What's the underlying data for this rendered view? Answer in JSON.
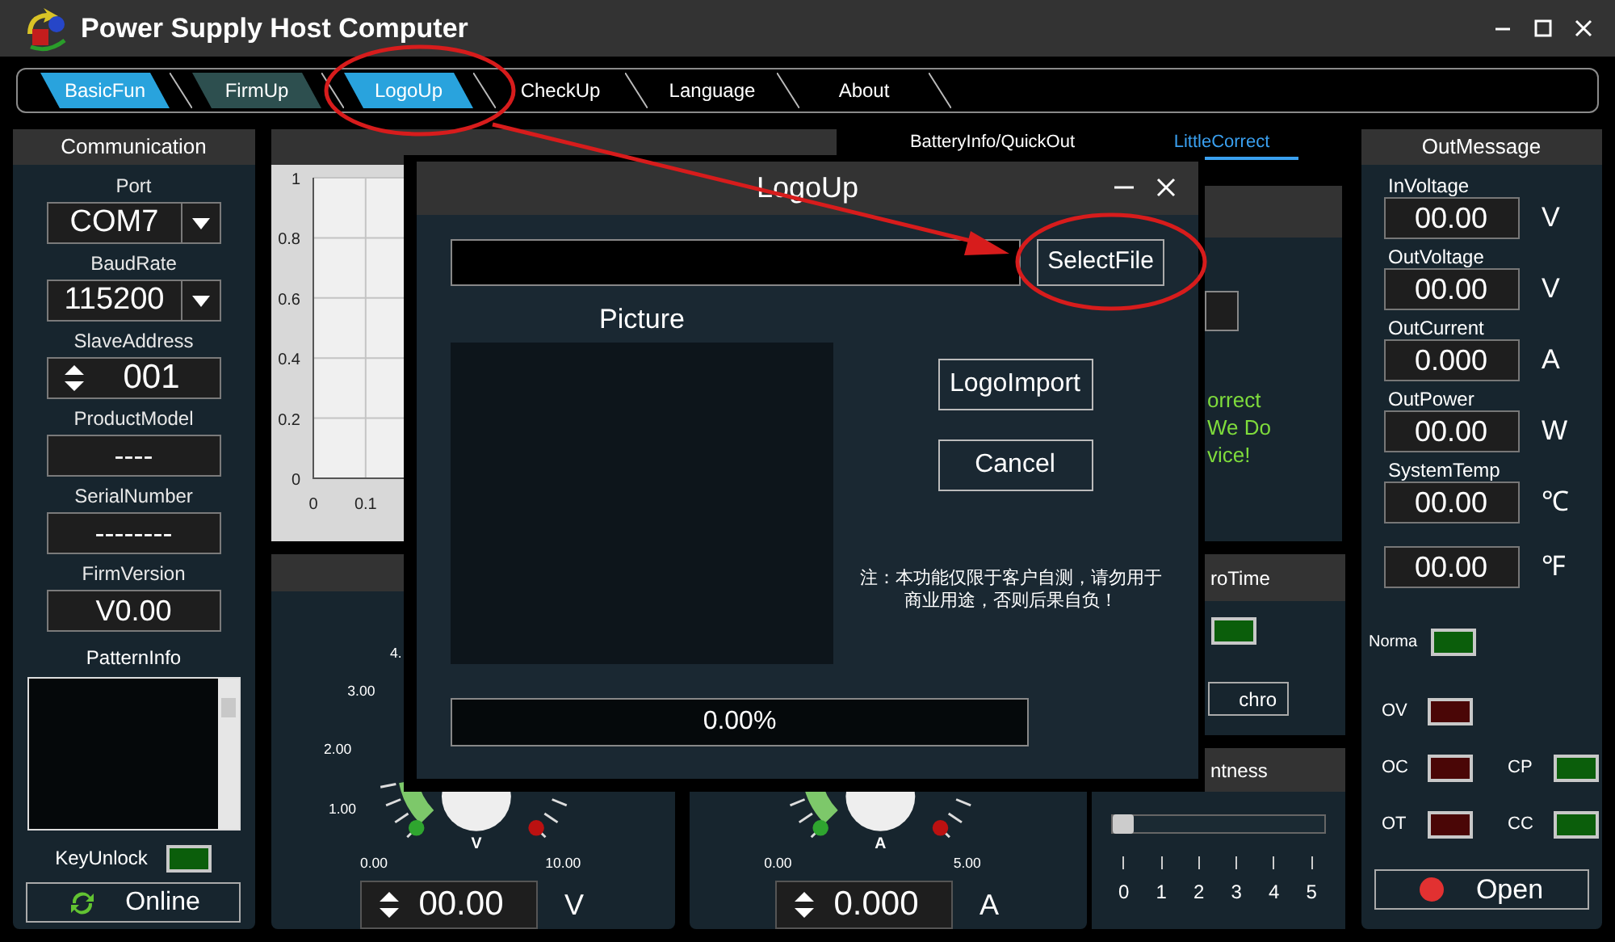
{
  "window": {
    "title": "Power Supply Host Computer"
  },
  "nav_tabs": [
    {
      "label": "BasicFun",
      "color": "#29a3dd"
    },
    {
      "label": "FirmUp",
      "color": "#2d4f4f"
    },
    {
      "label": "LogoUp",
      "color": "#29a3dd"
    },
    {
      "label": "CheckUp",
      "color": "#000000"
    },
    {
      "label": "Language",
      "color": "#000000"
    },
    {
      "label": "About",
      "color": "#000000"
    }
  ],
  "communication": {
    "title": "Communication",
    "fields": [
      {
        "kind": "dropdown",
        "label": "Port",
        "value": "COM7"
      },
      {
        "kind": "dropdown",
        "label": "BaudRate",
        "value": "115200"
      },
      {
        "kind": "spinner",
        "label": "SlaveAddress",
        "value": "001"
      },
      {
        "kind": "display",
        "label": "ProductModel",
        "value": "----"
      },
      {
        "kind": "display",
        "label": "SerialNumber",
        "value": "--------"
      },
      {
        "kind": "display",
        "label": "FirmVersion",
        "value": "V0.00"
      }
    ],
    "pattern_info_label": "PatternInfo",
    "key_unlock": {
      "label": "KeyUnlock",
      "on": true
    },
    "online_button": "Online"
  },
  "chart_panel": {
    "chart_data": {
      "type": "line",
      "xlim": [
        0,
        1
      ],
      "ylim": [
        0,
        1
      ],
      "grid": true,
      "xticks": [
        0,
        0.1
      ],
      "yticks": [
        0,
        0.2,
        0.4,
        0.6,
        0.8,
        1
      ]
    }
  },
  "side_tabs": [
    {
      "label": "BatteryInfo/QuickOut",
      "selected": false
    },
    {
      "label": "LittleCorrect",
      "selected": true
    }
  ],
  "correct_panel": {
    "message_lines": [
      "orrect",
      "We Do",
      "vice!"
    ]
  },
  "synchro_panel": {
    "title": "roTime",
    "indicator_on": true,
    "button": "chro"
  },
  "brightness_panel": {
    "title": "ntness",
    "level": 0,
    "scale": [
      "0",
      "1",
      "2",
      "3",
      "4",
      "5"
    ]
  },
  "gauges": [
    {
      "left_labels": [
        "4.",
        "3.00",
        "2.00",
        "1.00",
        "0.00"
      ],
      "right_labels": [
        "10.00"
      ],
      "dial_unit": "V",
      "value": "00.00",
      "unit": "V"
    },
    {
      "left_labels": [
        "0.00"
      ],
      "right_labels": [
        "5.00"
      ],
      "dial_unit": "A",
      "value": "0.000",
      "unit": "A"
    }
  ],
  "out_message": {
    "title": "OutMessage",
    "readings": [
      {
        "label": "InVoltage",
        "value": "00.00",
        "unit": "V"
      },
      {
        "label": "OutVoltage",
        "value": "00.00",
        "unit": "V"
      },
      {
        "label": "OutCurrent",
        "value": "0.000",
        "unit": "A"
      },
      {
        "label": "OutPower",
        "value": "00.00",
        "unit": "W"
      },
      {
        "label": "SystemTemp",
        "value": "00.00",
        "unit": "℃"
      },
      {
        "value": "00.00",
        "unit": "℉"
      }
    ],
    "indicator_rows": [
      [
        {
          "label": "Norma",
          "color": "#0b5e0b"
        }
      ],
      [
        {
          "label": "OV",
          "color": "#4a0606"
        }
      ],
      [
        {
          "label": "OC",
          "color": "#4a0606"
        },
        {
          "label": "CP",
          "color": "#0b5e0b"
        }
      ],
      [
        {
          "label": "OT",
          "color": "#4a0606"
        },
        {
          "label": "CC",
          "color": "#0b5e0b"
        }
      ]
    ],
    "open_button": "Open"
  },
  "dialog": {
    "title": "LogoUp",
    "select_button": "SelectFile",
    "picture_label": "Picture",
    "import_button": "LogoImport",
    "cancel_button": "Cancel",
    "note": "注：本功能仅限于客户自测，请勿用于商业用途，否则后果自负！",
    "progress": {
      "level": 0,
      "reading": "0.00%"
    }
  }
}
